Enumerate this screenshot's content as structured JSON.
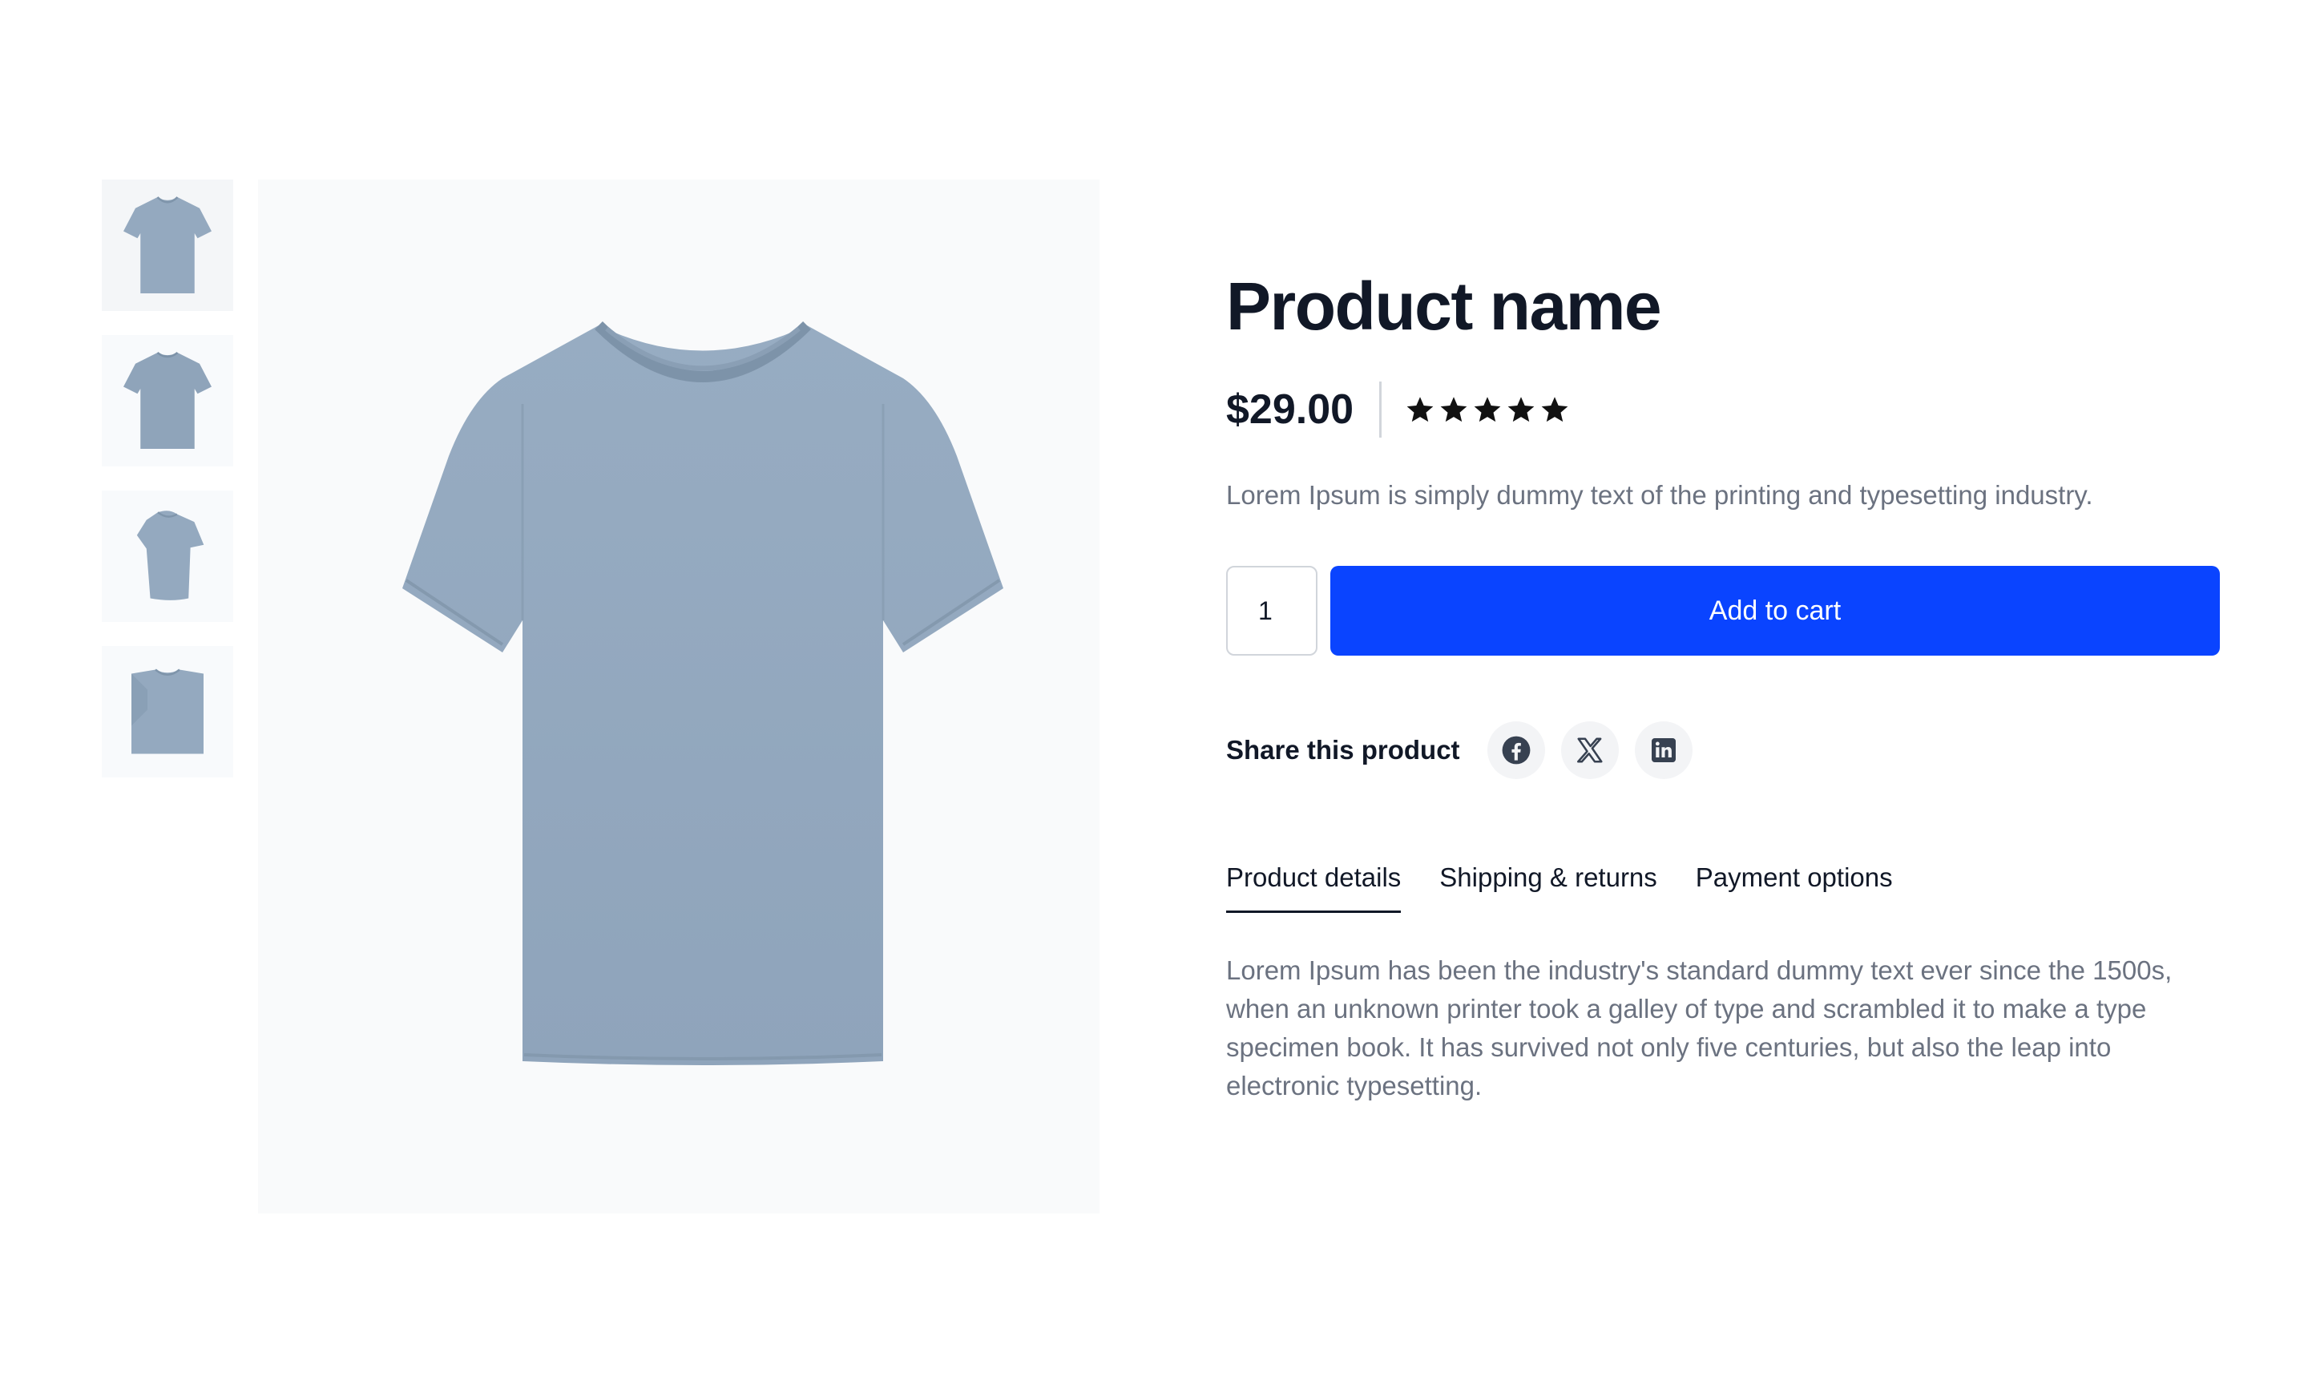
{
  "gallery": {
    "thumbnails": [
      "front-view",
      "front-view-alt",
      "side-view",
      "folded-view"
    ],
    "main_view": "front-view",
    "shirt_color": "#94a9bf"
  },
  "product": {
    "title": "Product name",
    "price": "$29.00",
    "rating": 5,
    "rating_max": 5,
    "description": "Lorem Ipsum is simply dummy text of the printing and typesetting industry."
  },
  "cart": {
    "quantity": "1",
    "add_label": "Add to cart",
    "accent_color": "#0a44ff"
  },
  "share": {
    "label": "Share this product",
    "networks": [
      "facebook-icon",
      "x-icon",
      "linkedin-icon"
    ]
  },
  "tabs": [
    {
      "label": "Product details",
      "active": true
    },
    {
      "label": "Shipping & returns",
      "active": false
    },
    {
      "label": "Payment options",
      "active": false
    }
  ],
  "details_text": "Lorem Ipsum has been the industry's standard dummy text ever since the 1500s, when an unknown printer took a galley of type and scrambled it to make a type specimen book. It has survived not only five centuries, but also the leap into electronic typesetting."
}
